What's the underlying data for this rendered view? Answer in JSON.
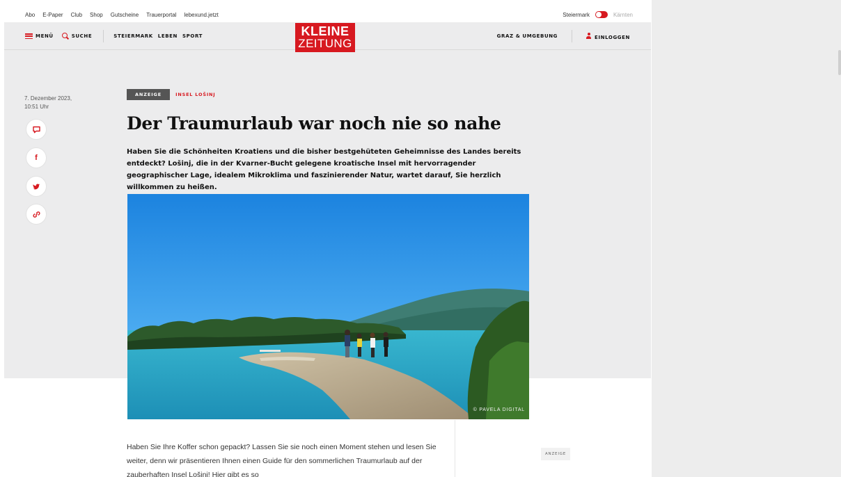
{
  "topbar": {
    "links": [
      "Abo",
      "E-Paper",
      "Club",
      "Shop",
      "Gutscheine",
      "Trauerportal",
      "lebexund.jetzt"
    ],
    "region_active": "Steiermark",
    "region_inactive": "Kärnten"
  },
  "nav": {
    "menu_label": "MENÜ",
    "search_label": "SUCHE",
    "categories": [
      "STEIERMARK",
      "LEBEN",
      "SPORT"
    ],
    "logo_line1": "KLEINE",
    "logo_line2": "ZEITUNG",
    "region_link": "GRAZ & UMGEBUNG",
    "login_label": "EINLOGGEN"
  },
  "article": {
    "date": "7. Dezember 2023,",
    "time": "10:51 Uhr",
    "badge": "ANZEIGE",
    "topic": "INSEL LOŠINJ",
    "headline": "Der Traumurlaub war noch nie so nahe",
    "lead": "Haben Sie die Schönheiten Kroatiens und die bisher bestgehüteten Geheimnisse des Landes bereits entdeckt? Lošinj, die in der Kvarner-Bucht gelegene kroatische Insel mit hervorragender geographischer Lage, idealem Mikroklima und faszinierender Natur, wartet darauf, Sie herzlich willkommen zu heißen.",
    "image_credit": "© PAVELA DIGITAL",
    "body": "Haben Sie Ihre Koffer schon gepackt? Lassen Sie sie noch einen Moment stehen und lesen Sie weiter, denn wir präsentieren Ihnen einen Guide für den sommerlichen Traumurlaub auf der zauberhaften Insel Lošinj! Hier gibt es so",
    "ad_label": "ANZEIGE"
  },
  "share": {
    "comment_icon": "comment-icon",
    "facebook_icon": "facebook-icon",
    "twitter_icon": "twitter-icon",
    "link_icon": "link-icon"
  },
  "colors": {
    "brand_red": "#d71920",
    "badge_gray": "#555555",
    "page_bg": "#ececed"
  }
}
